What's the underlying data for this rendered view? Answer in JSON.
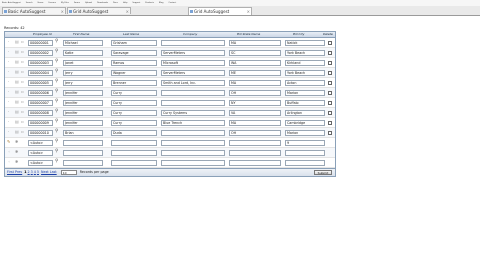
{
  "browser": {
    "bookmarks": [
      "Basic AutoSuggest",
      "Search",
      "Home",
      "Forums",
      "My Files",
      "Forms",
      "Upload",
      "Downloads",
      "Docs",
      "Help",
      "Support",
      "Products",
      "Blog",
      "Contact"
    ],
    "tabs": [
      {
        "label": "Basic AutoSuggest",
        "active": false
      },
      {
        "label": "Grid AutoSuggest",
        "active": false
      },
      {
        "label": "Grid AutoSuggest",
        "active": true
      }
    ]
  },
  "records_label": "Records: 42",
  "grid": {
    "headers": {
      "id": "Employee Id",
      "first": "First Name",
      "last": "Last Name",
      "company": "Company",
      "state": "Bill State Name",
      "city": "Bill City",
      "delete": "Delete"
    },
    "rows": [
      {
        "id": "000000001",
        "first": "Michael",
        "last": "Grisham",
        "company": "",
        "state": "MA",
        "city": "Natick"
      },
      {
        "id": "000000002",
        "first": "Katie",
        "last": "Saravage",
        "company": "ServerMeters",
        "state": "SC",
        "city": "York Beach"
      },
      {
        "id": "000000003",
        "first": "Janet",
        "last": "Ramos",
        "company": "Microsoft",
        "state": "WA",
        "city": "Kirkland"
      },
      {
        "id": "000000004",
        "first": "Jerry",
        "last": "Wagner",
        "company": "ServerMeters",
        "state": "ME",
        "city": "York Beach"
      },
      {
        "id": "000000005",
        "first": "Jerry",
        "last": "Brenner",
        "company": "Smith and Lord, Inc.",
        "state": "MA",
        "city": "Acton"
      },
      {
        "id": "000000006",
        "first": "Jennifer",
        "last": "Curry",
        "company": "",
        "state": "OH",
        "city": "Marion"
      },
      {
        "id": "000000007",
        "first": "Jennifer",
        "last": "Curry",
        "company": "",
        "state": "NY",
        "city": "Buffalo"
      },
      {
        "id": "000000008",
        "first": "Jennifer",
        "last": "Curry",
        "company": "Curry Systems",
        "state": "VA",
        "city": "Arlington"
      },
      {
        "id": "000000009",
        "first": "Jennifer",
        "last": "Curry",
        "company": "Blue Trench",
        "state": "MA",
        "city": "Cambridge"
      },
      {
        "id": "000000010",
        "first": "Brian",
        "last": "Duda",
        "company": "",
        "state": "OH",
        "city": "Marion"
      }
    ],
    "new_rows": [
      {
        "id": "<Auto>",
        "first": "",
        "last": "",
        "company": "",
        "state": "",
        "city": "9"
      },
      {
        "id": "<Auto>",
        "first": "",
        "last": "",
        "company": "",
        "state": "",
        "city": ""
      },
      {
        "id": "<Auto>",
        "first": "",
        "last": "",
        "company": "",
        "state": "",
        "city": ""
      }
    ],
    "footer": {
      "first_prev": "First Prev",
      "pages": [
        "1",
        "2",
        "3",
        "4",
        "5"
      ],
      "current_page": "1",
      "next_last": "Next Last",
      "per_page_value": "10",
      "per_page_label": "Records per page",
      "submit_label": "Submit"
    }
  }
}
